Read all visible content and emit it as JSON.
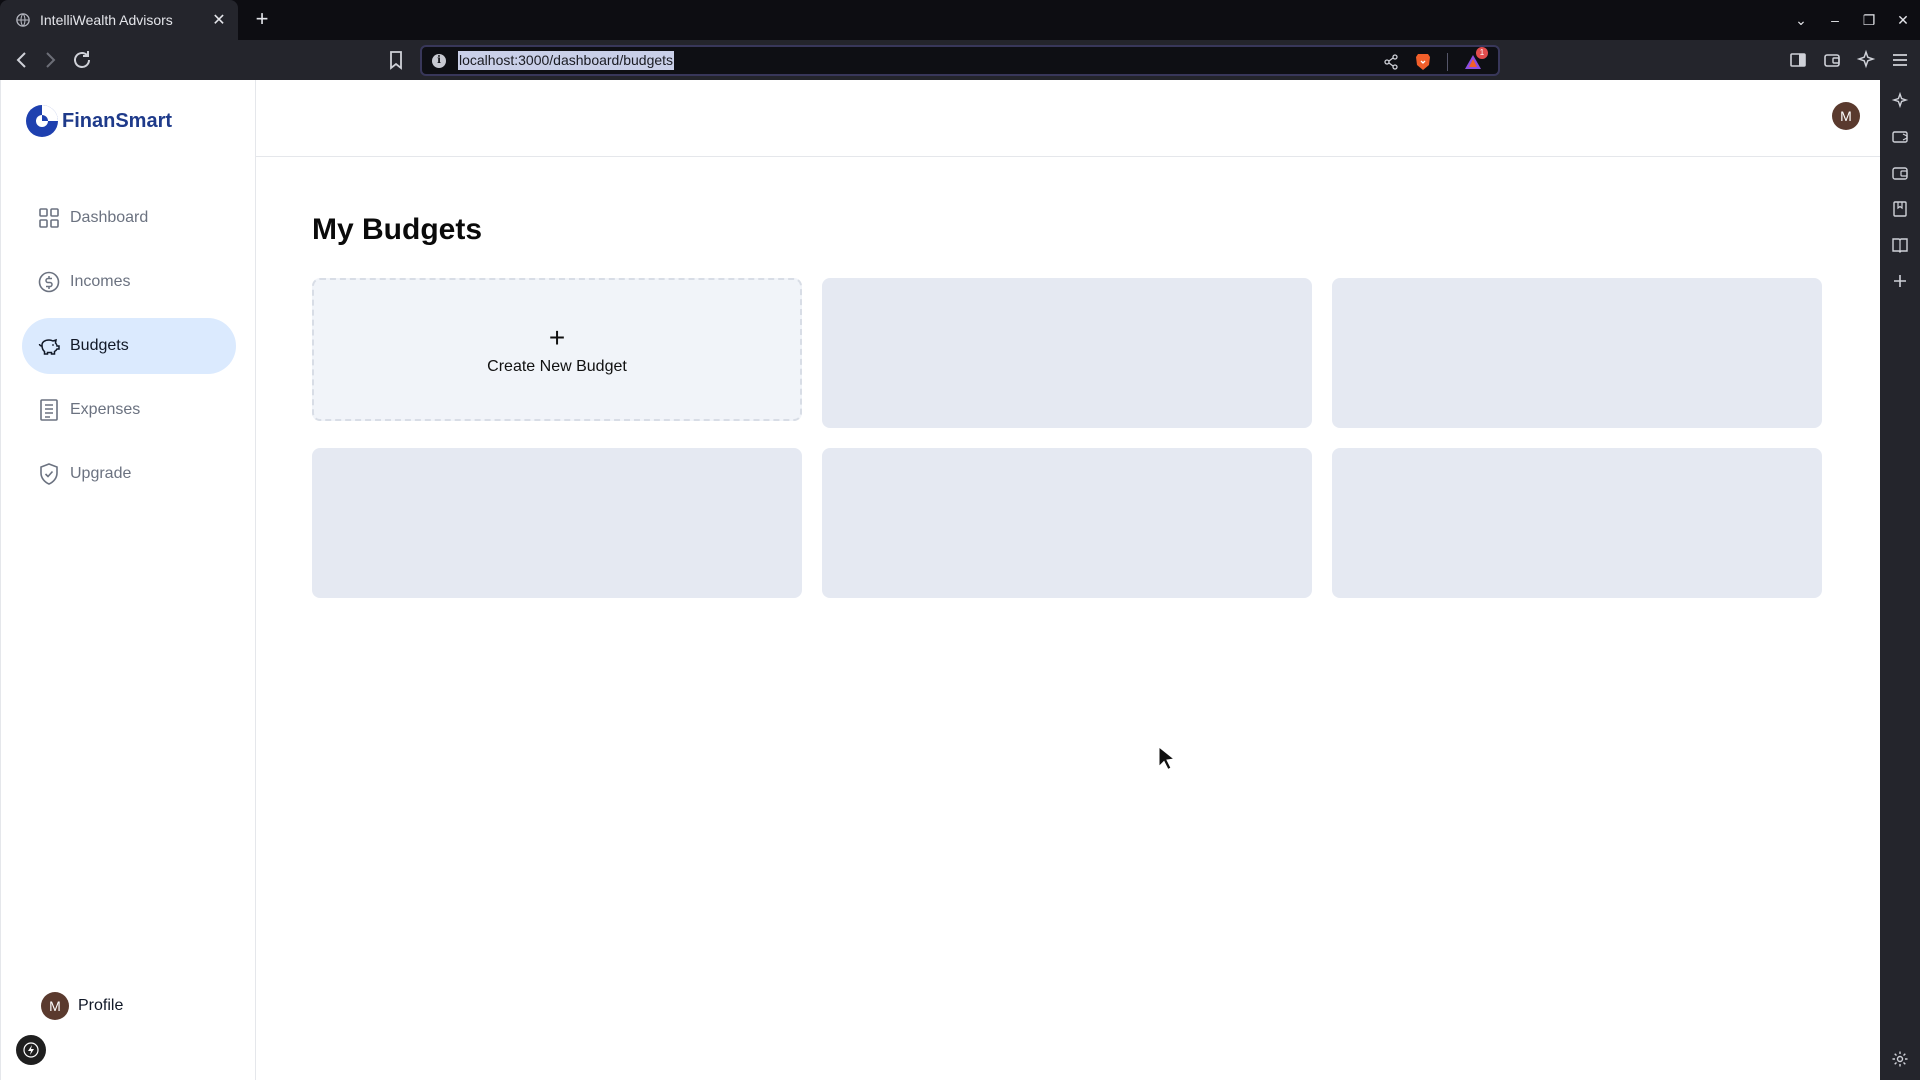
{
  "browser": {
    "tab_title": "IntelliWealth Advisors",
    "tab_close": "✕",
    "new_tab": "+",
    "url": "localhost:3000/dashboard/budgets",
    "rewards_badge": "1",
    "window_controls": {
      "dropdown": "⌄",
      "minimize": "–",
      "restore": "❐",
      "close": "✕"
    }
  },
  "app": {
    "brand": "FinanSmart",
    "brand_color": "#1e40af",
    "sidebar": {
      "items": [
        {
          "label": "Dashboard",
          "icon": "grid-icon"
        },
        {
          "label": "Incomes",
          "icon": "dollar-circle-icon"
        },
        {
          "label": "Budgets",
          "icon": "piggy-bank-icon",
          "active": true
        },
        {
          "label": "Expenses",
          "icon": "receipt-icon"
        },
        {
          "label": "Upgrade",
          "icon": "shield-check-icon"
        }
      ],
      "profile": {
        "avatar_initial": "M",
        "label": "Profile"
      }
    },
    "header": {
      "avatar_initial": "M"
    },
    "main": {
      "title": "My Budgets",
      "create_card": {
        "icon": "+",
        "label": "Create New Budget"
      }
    }
  }
}
